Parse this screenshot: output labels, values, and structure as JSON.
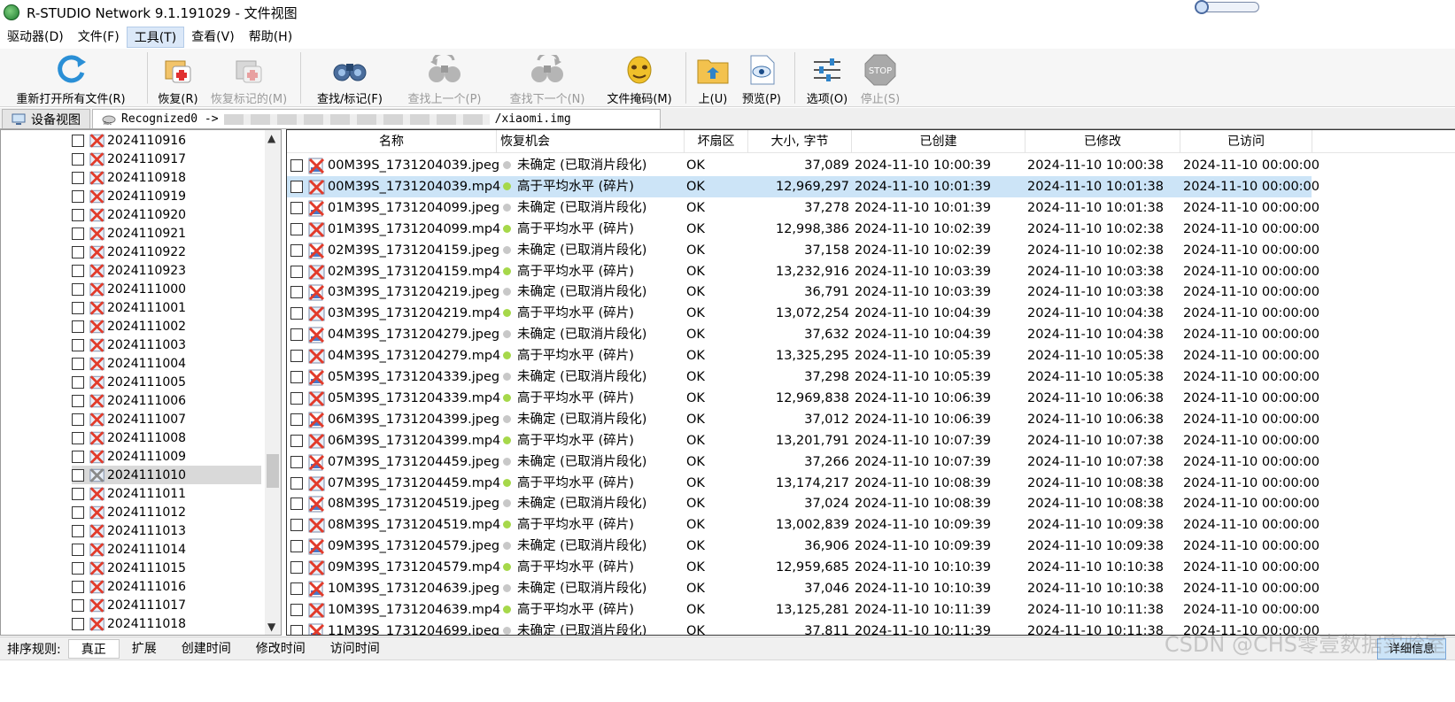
{
  "title": "R-STUDIO Network 9.1.191029 - 文件视图",
  "menu": [
    "驱动器(D)",
    "文件(F)",
    "工具(T)",
    "查看(V)",
    "帮助(H)"
  ],
  "toolbar": {
    "reopen": "重新打开所有文件(R)",
    "recover": "恢复(R)",
    "recover_marked": "恢复标记的(M)",
    "find": "查找/标记(F)",
    "find_prev": "查找上一个(P)",
    "find_next": "查找下一个(N)",
    "file_mask": "文件掩码(M)",
    "up": "上(U)",
    "preview": "预览(P)",
    "options": "选项(O)",
    "stop": "停止(S)"
  },
  "tabs": {
    "device_view": "设备视图",
    "recognized_prefix": "Recognized0 ->",
    "recognized_suffix": "/xiaomi.img"
  },
  "tree": [
    "2024110916",
    "2024110917",
    "2024110918",
    "2024110919",
    "2024110920",
    "2024110921",
    "2024110922",
    "2024110923",
    "2024111000",
    "2024111001",
    "2024111002",
    "2024111003",
    "2024111004",
    "2024111005",
    "2024111006",
    "2024111007",
    "2024111008",
    "2024111009",
    "2024111010",
    "2024111011",
    "2024111012",
    "2024111013",
    "2024111014",
    "2024111015",
    "2024111016",
    "2024111017",
    "2024111018"
  ],
  "table": {
    "headers": [
      "名称",
      "恢复机会",
      "坏扇区",
      "大小, 字节",
      "已创建",
      "已修改",
      "已访问"
    ],
    "rows": [
      [
        "00M39S_1731204039.jpeg",
        "未确定 (已取消片段化)",
        "OK",
        "37,089",
        "2024-11-10 10:00:39",
        "2024-11-10 10:00:38",
        "2024-11-10 00:00:00"
      ],
      [
        "00M39S_1731204039.mp4",
        "高于平均水平 (碎片)",
        "OK",
        "12,969,297",
        "2024-11-10 10:01:39",
        "2024-11-10 10:01:38",
        "2024-11-10 00:00:00"
      ],
      [
        "01M39S_1731204099.jpeg",
        "未确定 (已取消片段化)",
        "OK",
        "37,278",
        "2024-11-10 10:01:39",
        "2024-11-10 10:01:38",
        "2024-11-10 00:00:00"
      ],
      [
        "01M39S_1731204099.mp4",
        "高于平均水平 (碎片)",
        "OK",
        "12,998,386",
        "2024-11-10 10:02:39",
        "2024-11-10 10:02:38",
        "2024-11-10 00:00:00"
      ],
      [
        "02M39S_1731204159.jpeg",
        "未确定 (已取消片段化)",
        "OK",
        "37,158",
        "2024-11-10 10:02:39",
        "2024-11-10 10:02:38",
        "2024-11-10 00:00:00"
      ],
      [
        "02M39S_1731204159.mp4",
        "高于平均水平 (碎片)",
        "OK",
        "13,232,916",
        "2024-11-10 10:03:39",
        "2024-11-10 10:03:38",
        "2024-11-10 00:00:00"
      ],
      [
        "03M39S_1731204219.jpeg",
        "未确定 (已取消片段化)",
        "OK",
        "36,791",
        "2024-11-10 10:03:39",
        "2024-11-10 10:03:38",
        "2024-11-10 00:00:00"
      ],
      [
        "03M39S_1731204219.mp4",
        "高于平均水平 (碎片)",
        "OK",
        "13,072,254",
        "2024-11-10 10:04:39",
        "2024-11-10 10:04:38",
        "2024-11-10 00:00:00"
      ],
      [
        "04M39S_1731204279.jpeg",
        "未确定 (已取消片段化)",
        "OK",
        "37,632",
        "2024-11-10 10:04:39",
        "2024-11-10 10:04:38",
        "2024-11-10 00:00:00"
      ],
      [
        "04M39S_1731204279.mp4",
        "高于平均水平 (碎片)",
        "OK",
        "13,325,295",
        "2024-11-10 10:05:39",
        "2024-11-10 10:05:38",
        "2024-11-10 00:00:00"
      ],
      [
        "05M39S_1731204339.jpeg",
        "未确定 (已取消片段化)",
        "OK",
        "37,298",
        "2024-11-10 10:05:39",
        "2024-11-10 10:05:38",
        "2024-11-10 00:00:00"
      ],
      [
        "05M39S_1731204339.mp4",
        "高于平均水平 (碎片)",
        "OK",
        "12,969,838",
        "2024-11-10 10:06:39",
        "2024-11-10 10:06:38",
        "2024-11-10 00:00:00"
      ],
      [
        "06M39S_1731204399.jpeg",
        "未确定 (已取消片段化)",
        "OK",
        "37,012",
        "2024-11-10 10:06:39",
        "2024-11-10 10:06:38",
        "2024-11-10 00:00:00"
      ],
      [
        "06M39S_1731204399.mp4",
        "高于平均水平 (碎片)",
        "OK",
        "13,201,791",
        "2024-11-10 10:07:39",
        "2024-11-10 10:07:38",
        "2024-11-10 00:00:00"
      ],
      [
        "07M39S_1731204459.jpeg",
        "未确定 (已取消片段化)",
        "OK",
        "37,266",
        "2024-11-10 10:07:39",
        "2024-11-10 10:07:38",
        "2024-11-10 00:00:00"
      ],
      [
        "07M39S_1731204459.mp4",
        "高于平均水平 (碎片)",
        "OK",
        "13,174,217",
        "2024-11-10 10:08:39",
        "2024-11-10 10:08:38",
        "2024-11-10 00:00:00"
      ],
      [
        "08M39S_1731204519.jpeg",
        "未确定 (已取消片段化)",
        "OK",
        "37,024",
        "2024-11-10 10:08:39",
        "2024-11-10 10:08:38",
        "2024-11-10 00:00:00"
      ],
      [
        "08M39S_1731204519.mp4",
        "高于平均水平 (碎片)",
        "OK",
        "13,002,839",
        "2024-11-10 10:09:39",
        "2024-11-10 10:09:38",
        "2024-11-10 00:00:00"
      ],
      [
        "09M39S_1731204579.jpeg",
        "未确定 (已取消片段化)",
        "OK",
        "36,906",
        "2024-11-10 10:09:39",
        "2024-11-10 10:09:38",
        "2024-11-10 00:00:00"
      ],
      [
        "09M39S_1731204579.mp4",
        "高于平均水平 (碎片)",
        "OK",
        "12,959,685",
        "2024-11-10 10:10:39",
        "2024-11-10 10:10:38",
        "2024-11-10 00:00:00"
      ],
      [
        "10M39S_1731204639.jpeg",
        "未确定 (已取消片段化)",
        "OK",
        "37,046",
        "2024-11-10 10:10:39",
        "2024-11-10 10:10:38",
        "2024-11-10 00:00:00"
      ],
      [
        "10M39S_1731204639.mp4",
        "高于平均水平 (碎片)",
        "OK",
        "13,125,281",
        "2024-11-10 10:11:39",
        "2024-11-10 10:11:38",
        "2024-11-10 00:00:00"
      ],
      [
        "11M39S_1731204699.jpeg",
        "未确定 (已取消片段化)",
        "OK",
        "37,811",
        "2024-11-10 10:11:39",
        "2024-11-10 10:11:38",
        "2024-11-10 00:00:00"
      ]
    ]
  },
  "sort": {
    "label": "排序规则:",
    "options": [
      "真正",
      "扩展",
      "创建时间",
      "修改时间",
      "访问时间"
    ]
  },
  "detail_button": "详细信息",
  "watermark": "CSDN @CHS零壹数据实验室",
  "colors": {
    "selected_row": "#cce4f7",
    "dot_green": "#a6d84a",
    "dot_gray": "#c8c8c8",
    "x_red": "#e23b2b"
  }
}
